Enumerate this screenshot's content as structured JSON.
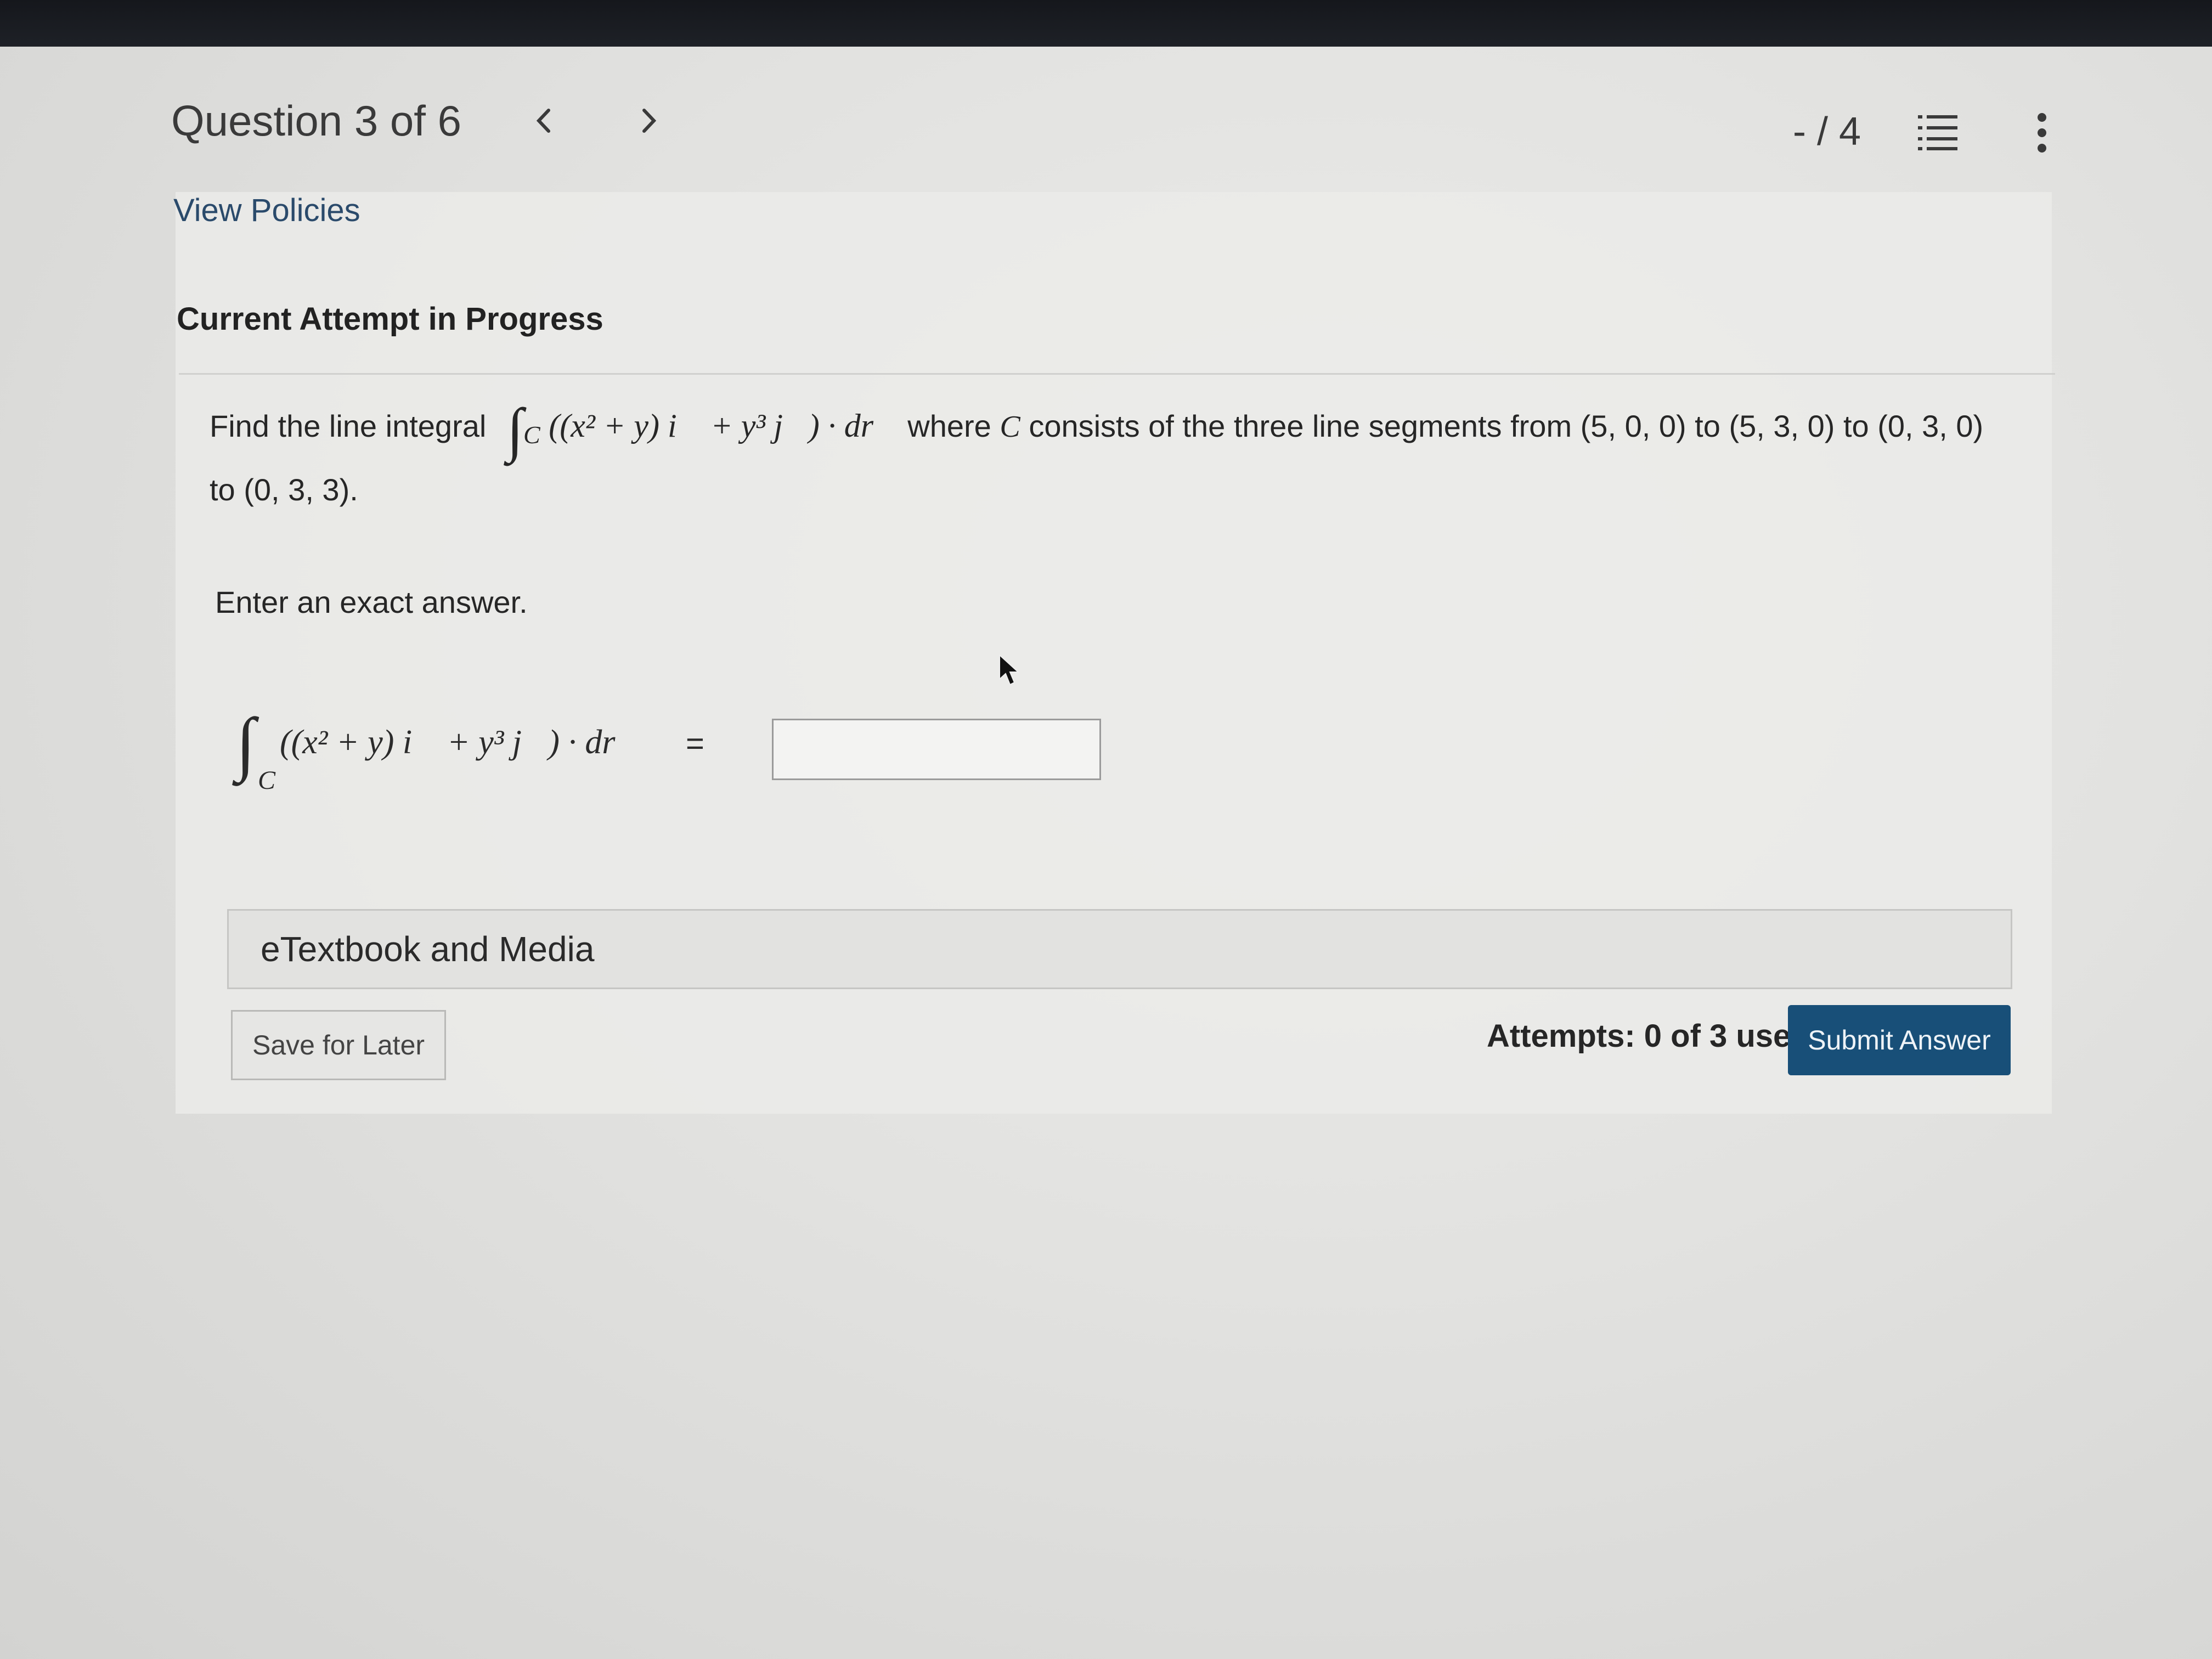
{
  "header": {
    "title": "Question 3 of 6",
    "prev_icon": "chevron-left-icon",
    "next_icon": "chevron-right-icon",
    "score": "- / 4",
    "list_icon": "list-icon",
    "menu_icon": "kebab-menu-icon"
  },
  "links": {
    "view_policies": "View Policies"
  },
  "attempt": {
    "heading": "Current Attempt in Progress"
  },
  "question": {
    "intro": "Find the line integral",
    "where": "where",
    "c_var": "C",
    "segments": "consists of the three line segments from (5, 0, 0) to (5, 3, 0) to (0, 3, 0)",
    "line2": "to (0, 3, 3).",
    "integral_body": "((x² + y) i⃗ + y³ j⃗) · dr⃗",
    "integral_sub": "C"
  },
  "instructions": {
    "enter": "Enter an exact answer."
  },
  "answer": {
    "equals": "=",
    "value": ""
  },
  "etextbook": {
    "label": "eTextbook and Media"
  },
  "footer": {
    "save_label": "Save for Later",
    "attempts": "Attempts: 0 of 3 used",
    "submit_label": "Submit Answer"
  },
  "colors": {
    "submit_bg": "#184f78",
    "link": "#2a4a6b"
  }
}
